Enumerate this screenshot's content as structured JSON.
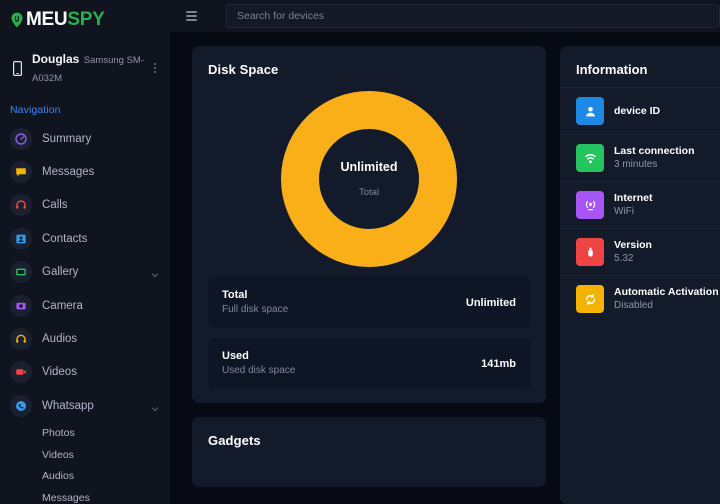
{
  "brand": {
    "name_part1": "MEU",
    "name_part2": "SPY",
    "pin_color": "#25b14c"
  },
  "sidebar": {
    "device": {
      "name": "Douglas",
      "model": "Samsung SM-A032M",
      "icon": "phone-icon",
      "menu_icon": "more-vertical-icon"
    },
    "nav_label": "Navigation",
    "items": [
      {
        "label": "Summary",
        "icon": "speedometer-icon",
        "color": "#8b5cf6",
        "expandable": false
      },
      {
        "label": "Messages",
        "icon": "message-icon",
        "color": "#f5b301",
        "expandable": false
      },
      {
        "label": "Calls",
        "icon": "headset-icon",
        "color": "#ef4444",
        "expandable": false
      },
      {
        "label": "Contacts",
        "icon": "contact-card-icon",
        "color": "#2f9bed",
        "expandable": false
      },
      {
        "label": "Gallery",
        "icon": "gallery-icon",
        "color": "#22c55e",
        "expandable": true
      },
      {
        "label": "Camera",
        "icon": "camera-icon",
        "color": "#a855f7",
        "expandable": false
      },
      {
        "label": "Audios",
        "icon": "headphones-icon",
        "color": "#f5b301",
        "expandable": false
      },
      {
        "label": "Videos",
        "icon": "video-icon",
        "color": "#ef4444",
        "expandable": false
      },
      {
        "label": "Whatsapp",
        "icon": "whatsapp-icon",
        "color": "#2f9bed",
        "expandable": true
      }
    ],
    "sub_items": [
      "Photos",
      "Videos",
      "Audios",
      "Messages"
    ]
  },
  "topbar": {
    "menu_icon": "hamburger-icon",
    "search_placeholder": "Search for devices",
    "search_value": ""
  },
  "disk_space": {
    "title": "Disk Space",
    "donut": {
      "center_value": "Unlimited",
      "center_label": "Total",
      "fill_color": "#faaf19",
      "percent": 100
    },
    "rows": [
      {
        "label": "Total",
        "desc": "Full disk space",
        "value": "Unlimited"
      },
      {
        "label": "Used",
        "desc": "Used disk space",
        "value": "141mb"
      }
    ]
  },
  "gadgets": {
    "title": "Gadgets"
  },
  "information": {
    "title": "Information",
    "rows": [
      {
        "name": "device ID",
        "value": "",
        "redacted": true,
        "icon": "person-icon",
        "color": "#1e88e5"
      },
      {
        "name": "Last connection",
        "value": "3 minutes",
        "redacted": false,
        "icon": "connection-icon",
        "color": "#22c55e"
      },
      {
        "name": "Internet",
        "value": "WiFi",
        "redacted": false,
        "icon": "wifi-icon",
        "color": "#a855f7"
      },
      {
        "name": "Version",
        "value": "5.32",
        "redacted": false,
        "icon": "bug-icon",
        "color": "#ef4444"
      },
      {
        "name": "Automatic Activation",
        "value": "Disabled",
        "redacted": false,
        "icon": "refresh-icon",
        "color": "#f5b301"
      }
    ]
  }
}
